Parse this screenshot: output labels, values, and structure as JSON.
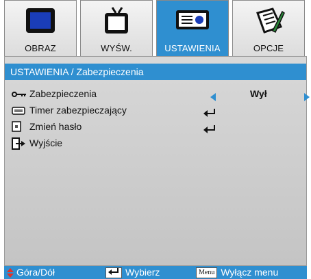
{
  "tabs": [
    {
      "label": "OBRAZ",
      "icon": "monitor-icon",
      "active": false
    },
    {
      "label": "WYŚW.",
      "icon": "tv-icon",
      "active": false
    },
    {
      "label": "USTAWIENIA",
      "icon": "projector-icon",
      "active": true
    },
    {
      "label": "OPCJE",
      "icon": "options-pen-icon",
      "active": false
    }
  ],
  "breadcrumb": "USTAWIENIA / Zabezpieczenia",
  "rows": {
    "security": {
      "label": "Zabezpieczenia",
      "value": "Wył"
    },
    "timer": {
      "label": "Timer zabezpieczający"
    },
    "password": {
      "label": "Zmień hasło"
    },
    "exit": {
      "label": "Wyjście"
    }
  },
  "footer": {
    "nav": "Góra/Dół",
    "select": "Wybierz",
    "menu_key": "Menu",
    "exit_menu": "Wyłącz menu"
  },
  "colors": {
    "accent": "#2f8fd0",
    "panel": "#cccccc",
    "icon_blue": "#1a3db8"
  }
}
